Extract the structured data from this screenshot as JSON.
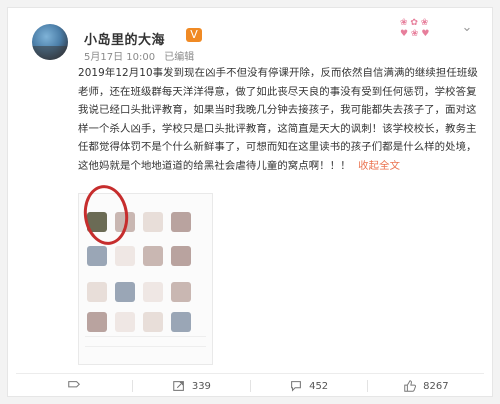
{
  "user": {
    "name": "小岛里的大海",
    "badge_icon": "vip-icon",
    "date": "5月17日 10:00",
    "source": "已编辑"
  },
  "post": {
    "text": "2019年12月10事发到现在凶手不但没有停课开除，反而依然自信满满的继续担任班级老师，还在班级群每天洋洋得意，做了如此丧尽天良的事没有受到任何惩罚，学校答复我说已经口头批评教育，如果当时我晚几分钟去接孩子，我可能都失去孩子了，面对这样一个杀人凶手，学校只是口头批评教育，这简直是天大的讽刺！该学校校长，教务主任都觉得体罚不是个什么新鲜事了，可想而知在这里读书的孩子们都是什么样的处境，这他妈就是个地地道道的给黑社会虐待儿童的窝点啊！！！",
    "collapse_label": "收起全文"
  },
  "actions": {
    "share_icon": "share-icon",
    "repost_count": "339",
    "comment_count": "452",
    "like_count": "8267"
  },
  "colors": {
    "accent": "#eb7350",
    "badge": "#f08a24",
    "circle": "#c62d2d"
  }
}
